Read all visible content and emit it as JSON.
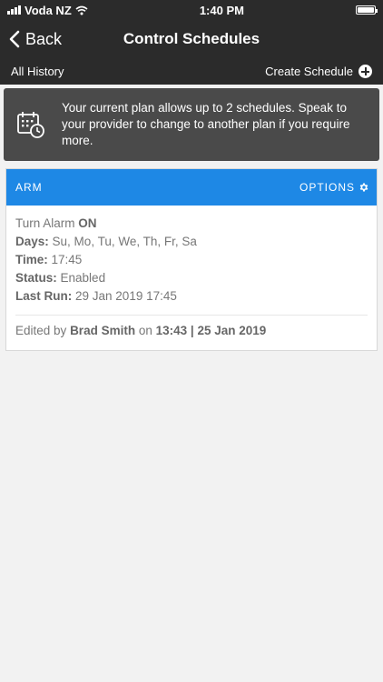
{
  "status_bar": {
    "carrier": "Voda NZ",
    "time": "1:40 PM"
  },
  "nav": {
    "back_label": "Back",
    "title": "Control Schedules"
  },
  "subbar": {
    "history_label": "All History",
    "create_label": "Create Schedule"
  },
  "notice": {
    "text": "Your current plan allows up to 2 schedules. Speak to your provider to change to another plan if you require more."
  },
  "schedule": {
    "name": "ARM",
    "options_label": "OPTIONS",
    "action_prefix": "Turn Alarm",
    "action_state": "ON",
    "days_label": "Days:",
    "days_value": "Su, Mo, Tu, We, Th, Fr, Sa",
    "time_label": "Time:",
    "time_value": "17:45",
    "status_label": "Status:",
    "status_value": "Enabled",
    "last_run_label": "Last Run:",
    "last_run_value": "29 Jan 2019 17:45",
    "edited_prefix": "Edited by",
    "editor": "Brad Smith",
    "edited_on": "on",
    "edited_when": "13:43 | 25 Jan 2019"
  },
  "colors": {
    "header_bg": "#2b2b2b",
    "accent": "#1e88e5",
    "notice_bg": "#4a4a4a",
    "page_bg": "#f2f2f2"
  }
}
